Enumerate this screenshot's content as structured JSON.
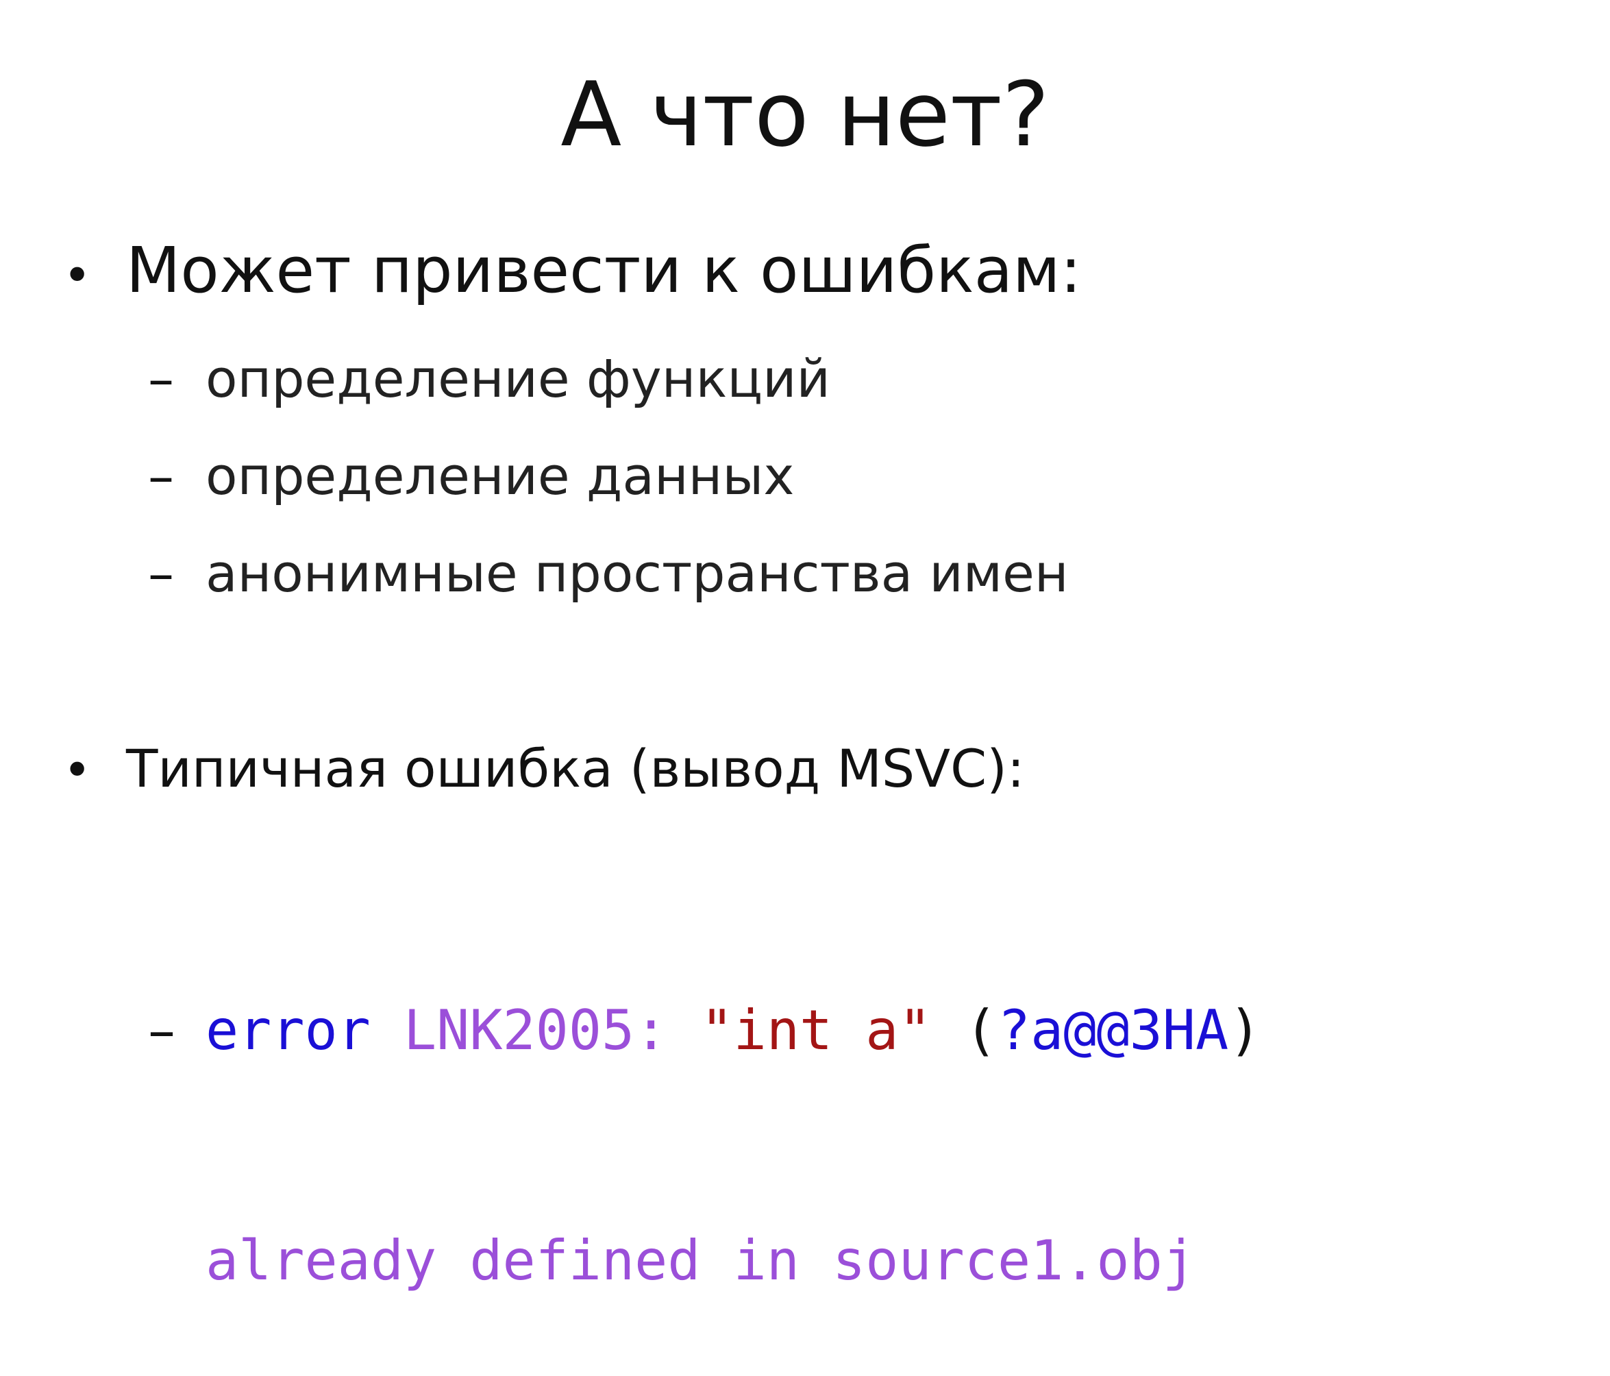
{
  "slide": {
    "title": "А что нет?",
    "bullets": [
      {
        "text": "Может привести к ошибкам:",
        "subitems": [
          "определение функций",
          "определение данных",
          "анонимные пространства имен"
        ]
      },
      {
        "text": "Типичная ошибка (вывод MSVC):"
      }
    ],
    "bullet_symbol": "•",
    "dash_symbol": "–",
    "code": {
      "line1": [
        {
          "text": "error",
          "color": "#1a0fd6"
        },
        {
          "text": " ",
          "color": "#111111"
        },
        {
          "text": "LNK2005:",
          "color": "#9b4fd9"
        },
        {
          "text": " ",
          "color": "#111111"
        },
        {
          "text": "\"int a\"",
          "color": "#a31515"
        },
        {
          "text": " (",
          "color": "#111111"
        },
        {
          "text": "?a@@3HA",
          "color": "#1a0fd6"
        },
        {
          "text": ")",
          "color": "#111111"
        }
      ],
      "line2": [
        {
          "text": "already defined in source1.obj",
          "color": "#9b4fd9"
        }
      ]
    }
  }
}
